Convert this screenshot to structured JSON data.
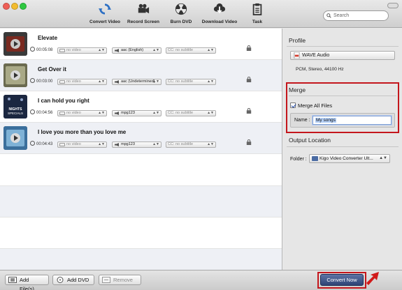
{
  "toolbar": {
    "tools": [
      {
        "label": "Convert Video",
        "icon": "convert-icon"
      },
      {
        "label": "Record Screen",
        "icon": "camera-icon"
      },
      {
        "label": "Burn DVD",
        "icon": "radiation-icon"
      },
      {
        "label": "Download Video",
        "icon": "download-icon"
      },
      {
        "label": "Task",
        "icon": "clipboard-icon"
      }
    ],
    "search_placeholder": "Search"
  },
  "files": [
    {
      "title": "Elevate",
      "duration": "00:05:08",
      "video": "no video",
      "audio": "aac (English)",
      "subtitle": "CC: no subtitle"
    },
    {
      "title": "Get Over it",
      "duration": "00:03:00",
      "video": "no video",
      "audio": "aac (Undetermined)",
      "subtitle": "CC: no subtitle"
    },
    {
      "title": "I can hold you right",
      "duration": "00:04:56",
      "video": "no video",
      "audio": "mpg123",
      "subtitle": "CC: no subtitle"
    },
    {
      "title": "I love you more than you love me",
      "duration": "00:04:43",
      "video": "no video",
      "audio": "mpg123",
      "subtitle": "CC: no subtitle"
    }
  ],
  "thumb_text": {
    "line1": "NIGHTS",
    "line2": "SPECIALS"
  },
  "bottom": {
    "add_files": "Add File(s)",
    "add_dvd": "Add DVD",
    "remove": "Remove",
    "convert": "Convert Now"
  },
  "panel": {
    "profile_heading": "Profile",
    "profile_value": "WAVE Audio",
    "profile_desc": "PCM, Stereo, 44100 Hz",
    "merge_heading": "Merge",
    "merge_all_label": "Merge All Files",
    "name_label": "Name :",
    "name_value": "My songs",
    "output_heading": "Output Location",
    "folder_label": "Folder :",
    "folder_value": "Kigo Video Converter Ult..."
  },
  "colors": {
    "highlight": "#c4161c",
    "convert": "#2e4476"
  }
}
